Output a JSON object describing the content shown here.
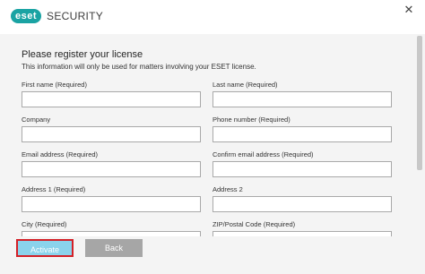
{
  "window": {
    "logo_text": "eset",
    "product": "SECURITY",
    "close_glyph": "✕"
  },
  "form": {
    "heading": "Please register your license",
    "subtext": "This information will only be used for matters involving your ESET license.",
    "fields": [
      {
        "label": "First name (Required)",
        "value": ""
      },
      {
        "label": "Last name (Required)",
        "value": ""
      },
      {
        "label": "Company",
        "value": ""
      },
      {
        "label": "Phone number (Required)",
        "value": ""
      },
      {
        "label": "Email address (Required)",
        "value": ""
      },
      {
        "label": "Confirm email address (Required)",
        "value": ""
      },
      {
        "label": "Address 1 (Required)",
        "value": ""
      },
      {
        "label": "Address 2",
        "value": ""
      },
      {
        "label": "City (Required)",
        "value": ""
      },
      {
        "label": "ZIP/Postal Code (Required)",
        "value": ""
      }
    ]
  },
  "footer": {
    "activate_label": "Activate",
    "back_label": "Back"
  },
  "colors": {
    "brand": "#1aa3a3",
    "activate_bg": "#8ad3ec",
    "highlight_border": "#d32027"
  }
}
